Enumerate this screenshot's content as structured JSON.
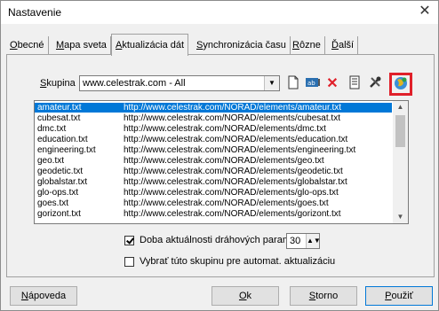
{
  "window": {
    "title": "Nastavenie"
  },
  "tabs": [
    {
      "pre": "",
      "u": "O",
      "post": "becné"
    },
    {
      "pre": "",
      "u": "M",
      "post": "apa sveta"
    },
    {
      "pre": "",
      "u": "A",
      "post": "ktualizácia dát"
    },
    {
      "pre": "",
      "u": "S",
      "post": "ynchronizácia času"
    },
    {
      "pre": "",
      "u": "R",
      "post": "ôzne"
    },
    {
      "pre": "",
      "u": "Ď",
      "post": "alší"
    }
  ],
  "group": {
    "label_u": "S",
    "label_rest": "kupina",
    "value": "www.celestrak.com - All"
  },
  "toolbar": [
    "new-file-icon",
    "rename-icon",
    "delete-icon",
    "document-icon",
    "tools-icon",
    "globe-update-icon"
  ],
  "list": [
    [
      "amateur.txt",
      "http://www.celestrak.com/NORAD/elements/amateur.txt"
    ],
    [
      "cubesat.txt",
      "http://www.celestrak.com/NORAD/elements/cubesat.txt"
    ],
    [
      "dmc.txt",
      "http://www.celestrak.com/NORAD/elements/dmc.txt"
    ],
    [
      "education.txt",
      "http://www.celestrak.com/NORAD/elements/education.txt"
    ],
    [
      "engineering.txt",
      "http://www.celestrak.com/NORAD/elements/engineering.txt"
    ],
    [
      "geo.txt",
      "http://www.celestrak.com/NORAD/elements/geo.txt"
    ],
    [
      "geodetic.txt",
      "http://www.celestrak.com/NORAD/elements/geodetic.txt"
    ],
    [
      "globalstar.txt",
      "http://www.celestrak.com/NORAD/elements/globalstar.txt"
    ],
    [
      "glo-ops.txt",
      "http://www.celestrak.com/NORAD/elements/glo-ops.txt"
    ],
    [
      "goes.txt",
      "http://www.celestrak.com/NORAD/elements/goes.txt"
    ],
    [
      "gorizont.txt",
      "http://www.celestrak.com/NORAD/elements/gorizont.txt"
    ]
  ],
  "options": {
    "validity_label": "Doba aktuálnosti dráhových param",
    "validity_value": "30",
    "auto_label": "Vybrať túto skupinu pre automat. aktualizáciu"
  },
  "buttons": {
    "help_u": "N",
    "help_rest": "ápoveda",
    "ok_u": "O",
    "ok_rest": "k",
    "cancel_u": "S",
    "cancel_rest": "torno",
    "apply_u": "P",
    "apply_rest": "oužiť"
  }
}
